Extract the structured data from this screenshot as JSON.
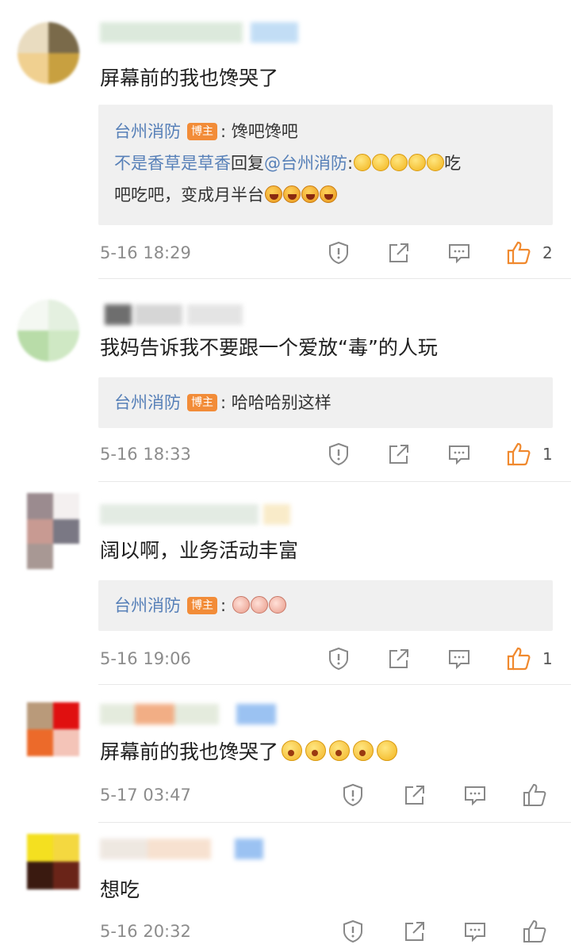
{
  "comments": [
    {
      "text": "屏幕前的我也馋哭了",
      "replies": [
        {
          "author": "台州消防",
          "tag": "博主",
          "sep": ": ",
          "text": "馋吧馋吧"
        },
        {
          "author": "不是香草是草香",
          "verb": "回复",
          "mention": "@台州消防",
          "sep": ":",
          "line1_tail": "吃",
          "line2": "吧吃吧，变成月半台"
        }
      ],
      "time": "5-16 18:29",
      "likes": "2",
      "liked": true
    },
    {
      "text": "我妈告诉我不要跟一个爱放“毒”的人玩",
      "replies": [
        {
          "author": "台州消防",
          "tag": "博主",
          "sep": ": ",
          "text": "哈哈哈别这样"
        }
      ],
      "time": "5-16 18:33",
      "likes": "1",
      "liked": true
    },
    {
      "text": "阔以啊，业务活动丰富",
      "replies": [
        {
          "author": "台州消防",
          "tag": "博主",
          "sep": ": ",
          "text": ""
        }
      ],
      "time": "5-16 19:06",
      "likes": "1",
      "liked": true
    },
    {
      "text": "屏幕前的我也馋哭了",
      "time": "5-17 03:47",
      "likes": "",
      "liked": false
    },
    {
      "text": "想吃",
      "time": "5-16 20:32",
      "likes": "",
      "liked": false
    }
  ],
  "icons": {
    "report": "report-icon",
    "share": "share-icon",
    "comment": "comment-icon",
    "like": "thumbs-up-icon"
  },
  "colors": {
    "accent_like": "#f0892e",
    "link": "#5780b8",
    "tag_bg": "#f28c38",
    "reply_bg": "#f0f0f0",
    "meta_text": "#8c8c8c"
  }
}
